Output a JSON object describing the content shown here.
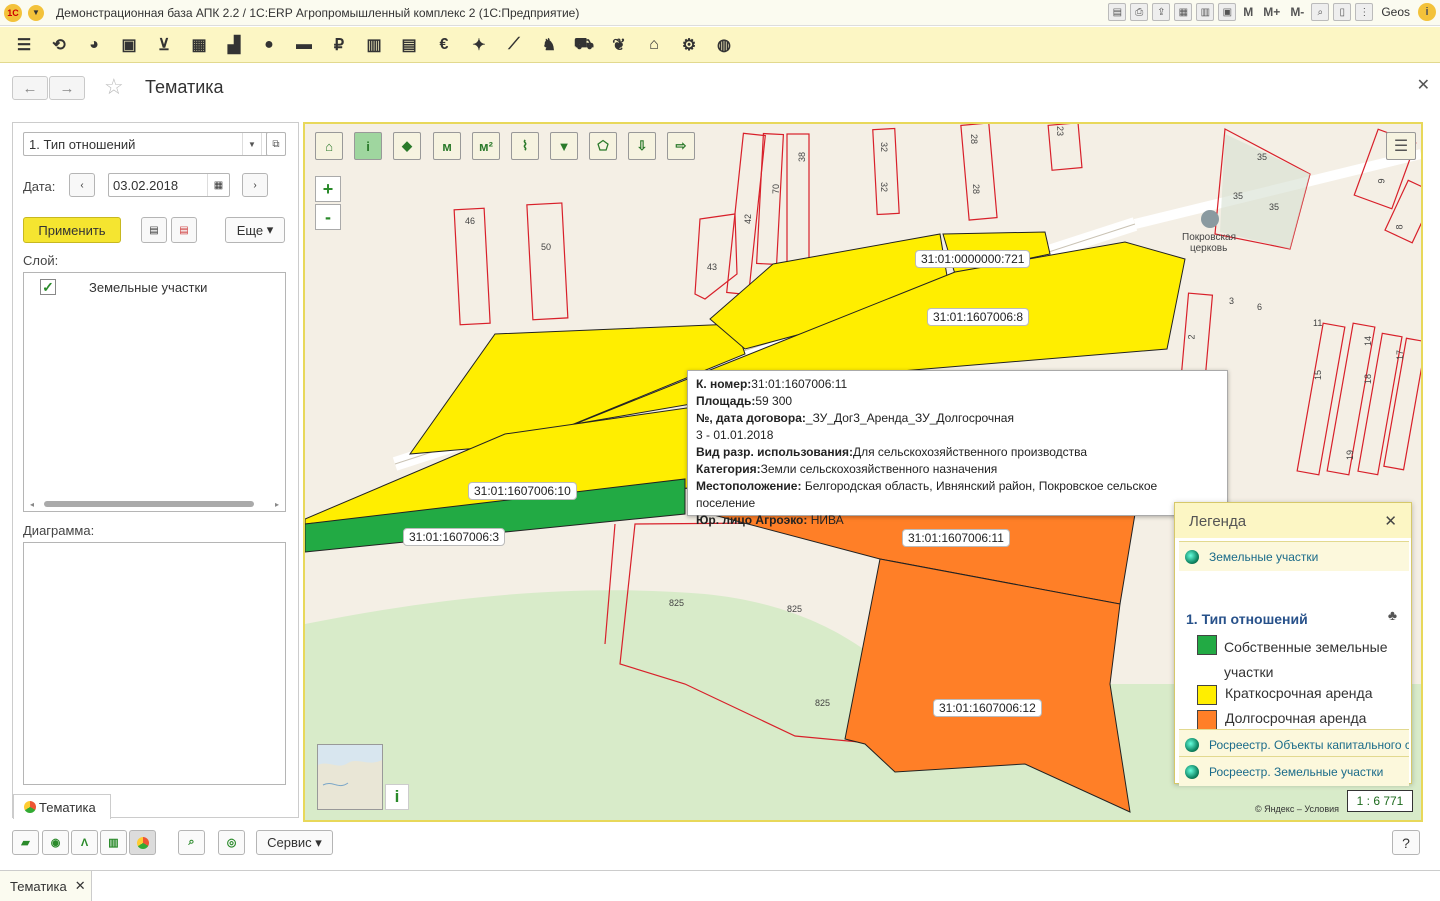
{
  "window": {
    "title": "Демонстрационная база АПК 2.2 / 1С:ERP Агропромышленный комплекс 2   (1С:Предприятие)",
    "logo_text": "1С",
    "right_buttons": [
      "M",
      "M+",
      "M-"
    ],
    "user": "Geos"
  },
  "form": {
    "title": "Тематика"
  },
  "left": {
    "selector_value": "1. Тип отношений",
    "date_label": "Дата:",
    "date_value": "03.02.2018",
    "apply_label": "Применить",
    "more_label": "Еще",
    "layer_label": "Слой:",
    "layers": [
      {
        "name": "Земельные участки",
        "checked": true
      }
    ],
    "diagram_label": "Диаграмма:",
    "tab_label": "Тематика"
  },
  "map": {
    "parcels": [
      {
        "label": "31:01:0000000:721"
      },
      {
        "label": "31:01:1607006:8"
      },
      {
        "label": "31:01:1607006:10"
      },
      {
        "label": "31:01:1607006:3"
      },
      {
        "label": "31:01:1607006:11"
      },
      {
        "label": "31:01:1607006:12"
      }
    ],
    "place_label_1": "Покровская",
    "place_label_2": "церковь",
    "street_numbers": [
      "46",
      "50",
      "43",
      "42",
      "70",
      "38",
      "32",
      "32",
      "28",
      "28",
      "23",
      "35",
      "35",
      "35",
      "3",
      "6",
      "11",
      "2",
      "14",
      "15",
      "17",
      "18",
      "19",
      "9",
      "8",
      "825",
      "825",
      "825"
    ],
    "popup": {
      "cadastral_key": "К. номер:",
      "cadastral_value": "31:01:1607006:11",
      "area_key": "Площадь:",
      "area_value": "59 300",
      "contract_key": "№, дата договора:",
      "contract_value": "_ЗУ_Дог3_Аренда_ЗУ_Долгосрочная",
      "contract_line2": "3 - 01.01.2018",
      "usage_key": "Вид разр. использования:",
      "usage_value": "Для сельскохозяйственного производства",
      "category_key": "Категория:",
      "category_value": "Земли сельскохозяйственного назначения",
      "location_key": "Местоположение:",
      "location_value": "Белгородская область, Ивнянский район, Покровское сельское поселение",
      "entity_key": "Юр. лицо Агроэко:",
      "entity_value": "НИВА"
    },
    "legend": {
      "title": "Легенда",
      "layer1": "Земельные участки",
      "subtitle": "1. Тип отношений",
      "items": [
        {
          "label": "Собственные земельные участки",
          "color": "#22aa44"
        },
        {
          "label": "Краткосрочная аренда",
          "color": "#ffee00"
        },
        {
          "label": "Долгосрочная аренда",
          "color": "#ff7f27"
        }
      ],
      "layer2": "Росреестр. Объекты капитального строительства",
      "layer3": "Росреестр. Земельные участки"
    },
    "scale": "1 : 6 771",
    "copyright": "© Яндекс – Условия"
  },
  "bottom": {
    "service_label": "Сервис",
    "help_label": "?"
  },
  "status": {
    "tab_label": "Тематика"
  },
  "colors": {
    "own": "#22aa44",
    "short_lease": "#ffee00",
    "long_lease": "#ff7f27",
    "accent_yellow": "#fcf6c4"
  }
}
